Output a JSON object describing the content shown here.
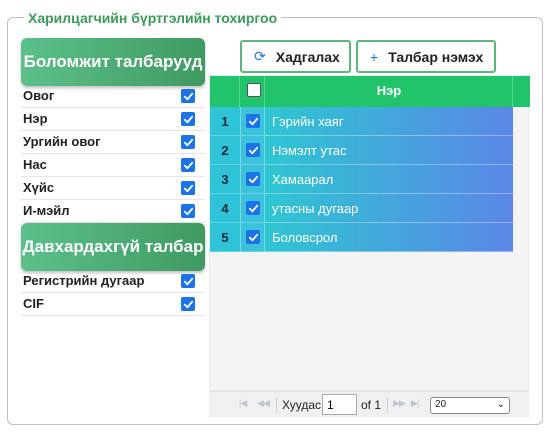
{
  "fieldset": {
    "legend": "Харилцагчийн бүртгэлийн тохиргоо"
  },
  "available_fields": {
    "title": "Боломжит талбарууд",
    "items": [
      {
        "label": "Овог",
        "checked": true
      },
      {
        "label": "Нэр",
        "checked": true
      },
      {
        "label": "Ургийн овог",
        "checked": true
      },
      {
        "label": "Нас",
        "checked": true
      },
      {
        "label": "Хүйс",
        "checked": true
      },
      {
        "label": "И-мэйл",
        "checked": true
      }
    ]
  },
  "unique_fields": {
    "title": "Давхардахгүй талбар",
    "items": [
      {
        "label": "Регистрийн дугаар",
        "checked": true
      },
      {
        "label": "CIF",
        "checked": true
      }
    ]
  },
  "toolbar": {
    "save_label": "Хадгалах",
    "save_icon": "refresh-icon",
    "add_label": "Талбар нэмэх",
    "add_icon": "plus-icon"
  },
  "grid": {
    "column_name": "Нэр",
    "header_checked": false,
    "rows": [
      {
        "num": "1",
        "checked": true,
        "name": "Гэрийн хаяг"
      },
      {
        "num": "2",
        "checked": true,
        "name": "Нэмэлт утас"
      },
      {
        "num": "3",
        "checked": true,
        "name": "Хамаарал"
      },
      {
        "num": "4",
        "checked": true,
        "name": "утасны дугаар"
      },
      {
        "num": "5",
        "checked": true,
        "name": "Боловсрол"
      }
    ]
  },
  "pager": {
    "page_label": "Хуудас",
    "page_value": "1",
    "of_label": "of 1",
    "rows_per_page": "20"
  },
  "colors": {
    "accent_green": "#21c46a",
    "checkbox_blue": "#1a73e8",
    "row_gradient_start": "#2ec6d2",
    "row_gradient_end": "#5a86e6"
  }
}
